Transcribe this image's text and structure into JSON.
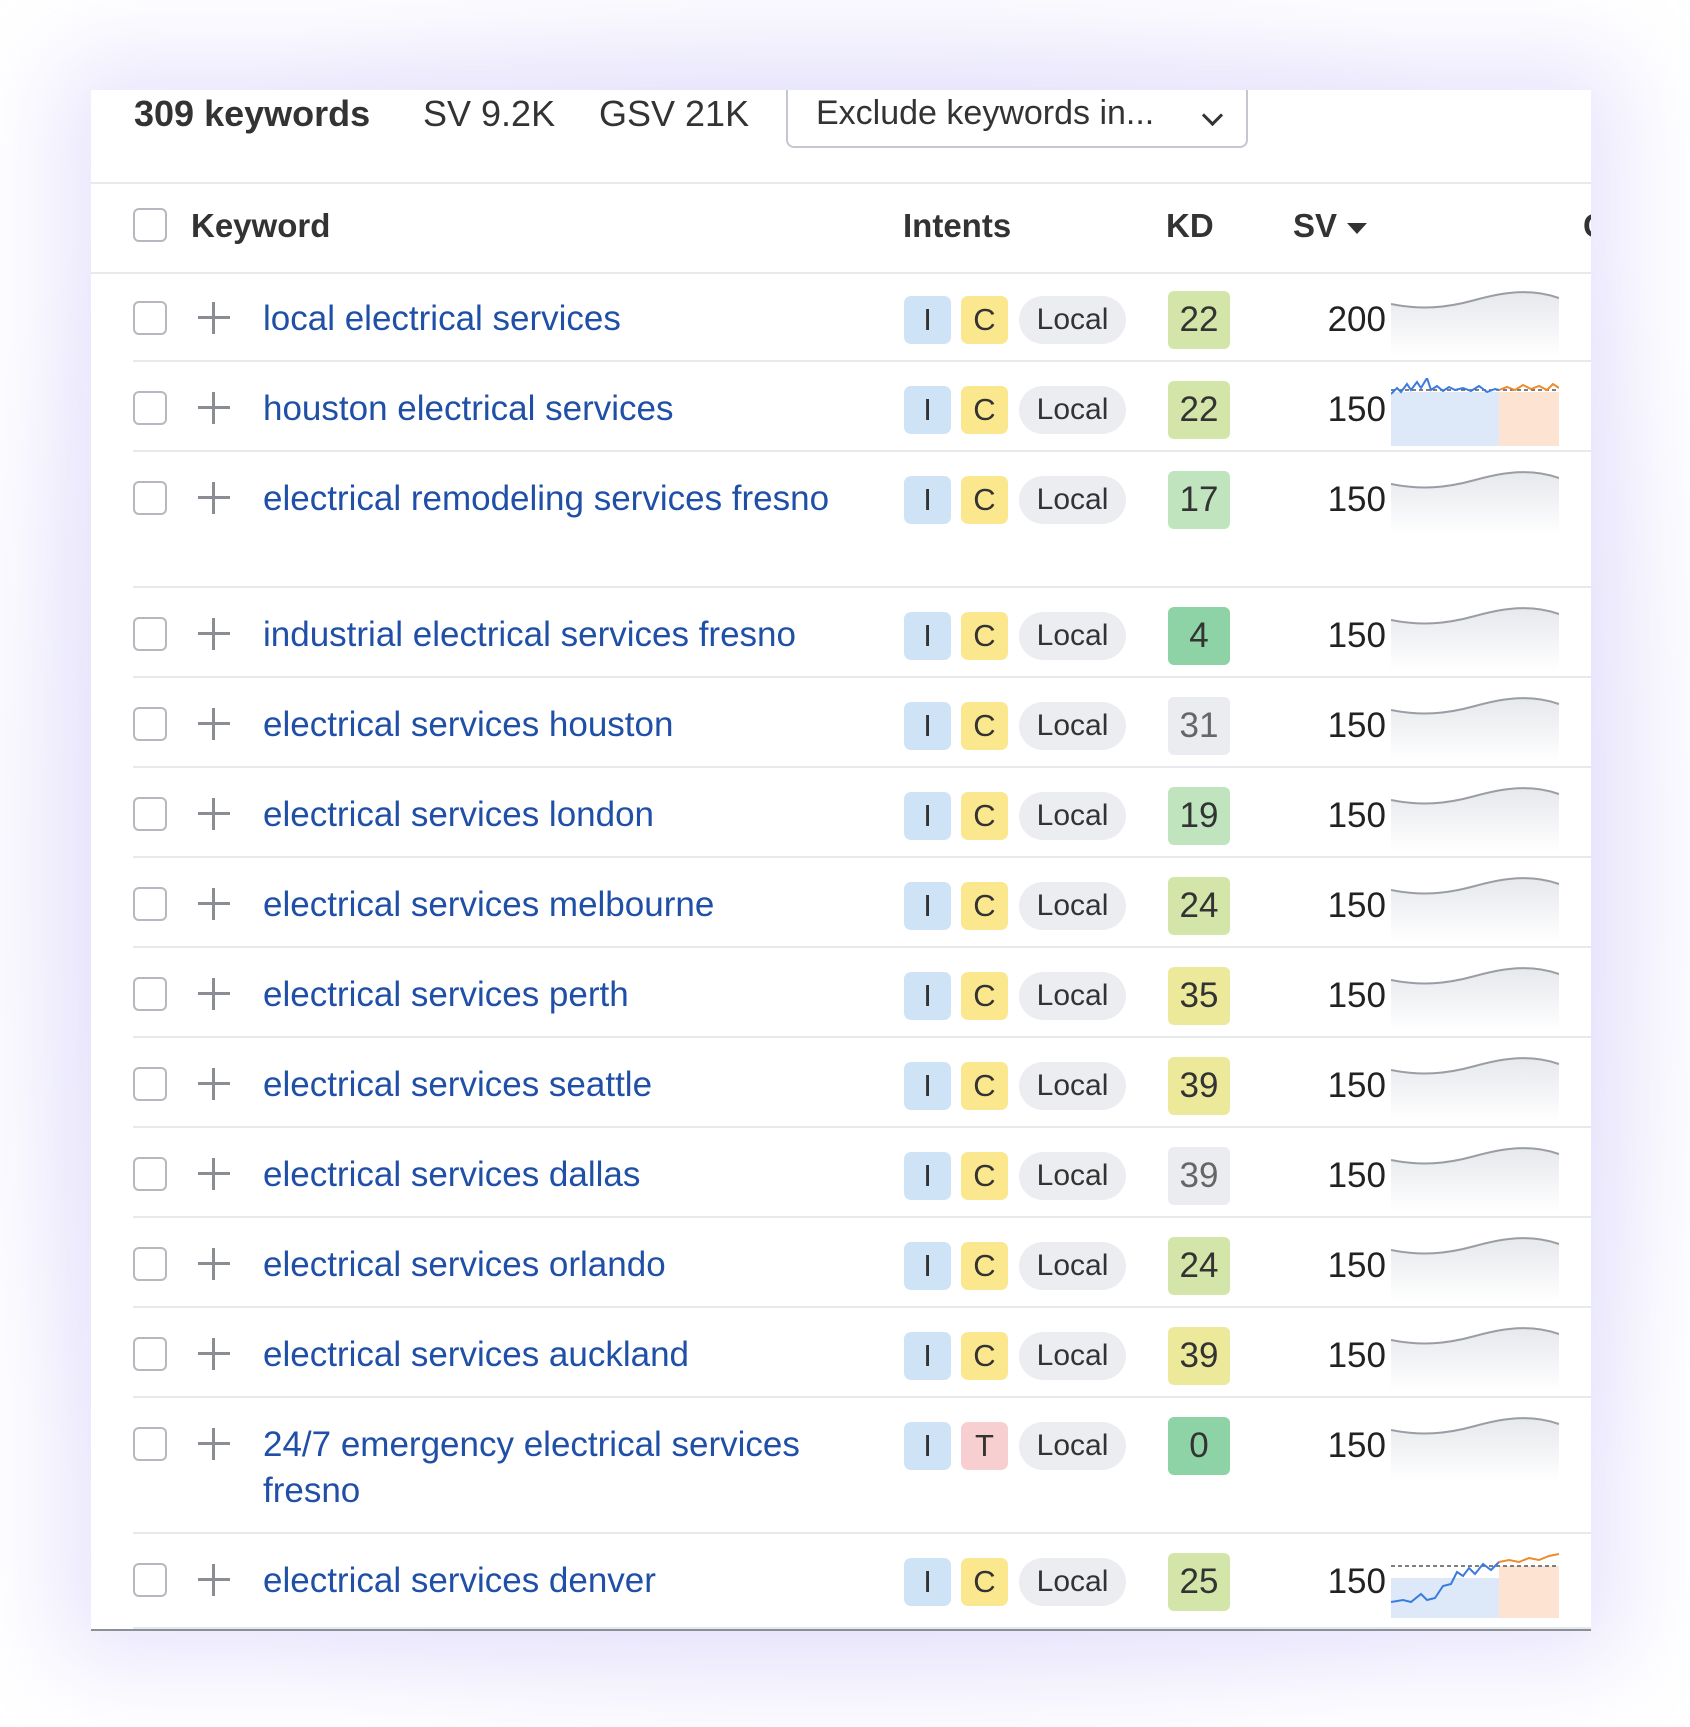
{
  "summary": {
    "keywords_count": "309 keywords",
    "sv": "SV 9.2K",
    "gsv": "GSV 21K",
    "exclude_label": "Exclude keywords in..."
  },
  "headers": {
    "keyword": "Keyword",
    "intents": "Intents",
    "kd": "KD",
    "sv": "SV",
    "sort_icon": "sort-desc-icon",
    "cut_off": "C"
  },
  "colors": {
    "link": "#1f4fa6",
    "intent_informational": "#cfe3f6",
    "intent_commercial": "#fbe78e",
    "intent_transactional": "#f8cfd0",
    "local_badge": "#ebedf0",
    "kd_gray": "#ebecef",
    "trend_blue": "#3a7be0",
    "trend_orange": "#f08a2c"
  },
  "rows": [
    {
      "keyword": "local electrical services",
      "intent1": "I",
      "intent2": "C",
      "intent2_type": "commercial",
      "local": "Local",
      "kd": "22",
      "kd_color": "#d3e5a9",
      "sv": "200",
      "trend": "wave"
    },
    {
      "keyword": "houston electrical services",
      "intent1": "I",
      "intent2": "C",
      "intent2_type": "commercial",
      "local": "Local",
      "kd": "22",
      "kd_color": "#d3e5a9",
      "sv": "150",
      "trend": "data-flat"
    },
    {
      "keyword": "electrical remodeling services fresno",
      "intent1": "I",
      "intent2": "C",
      "intent2_type": "commercial",
      "local": "Local",
      "kd": "17",
      "kd_color": "#bfe4be",
      "sv": "150",
      "trend": "wave"
    },
    {
      "keyword": "industrial electrical services fresno",
      "intent1": "I",
      "intent2": "C",
      "intent2_type": "commercial",
      "local": "Local",
      "kd": "4",
      "kd_color": "#8dd3a6",
      "sv": "150",
      "trend": "wave"
    },
    {
      "keyword": "electrical services houston",
      "intent1": "I",
      "intent2": "C",
      "intent2_type": "commercial",
      "local": "Local",
      "kd": "31",
      "kd_color": "#ebecef",
      "sv": "150",
      "trend": "wave"
    },
    {
      "keyword": "electrical services london",
      "intent1": "I",
      "intent2": "C",
      "intent2_type": "commercial",
      "local": "Local",
      "kd": "19",
      "kd_color": "#bfe4be",
      "sv": "150",
      "trend": "wave"
    },
    {
      "keyword": "electrical services melbourne",
      "intent1": "I",
      "intent2": "C",
      "intent2_type": "commercial",
      "local": "Local",
      "kd": "24",
      "kd_color": "#d3e5a9",
      "sv": "150",
      "trend": "wave"
    },
    {
      "keyword": "electrical services perth",
      "intent1": "I",
      "intent2": "C",
      "intent2_type": "commercial",
      "local": "Local",
      "kd": "35",
      "kd_color": "#ece99a",
      "sv": "150",
      "trend": "wave"
    },
    {
      "keyword": "electrical services seattle",
      "intent1": "I",
      "intent2": "C",
      "intent2_type": "commercial",
      "local": "Local",
      "kd": "39",
      "kd_color": "#ece99a",
      "sv": "150",
      "trend": "wave"
    },
    {
      "keyword": "electrical services dallas",
      "intent1": "I",
      "intent2": "C",
      "intent2_type": "commercial",
      "local": "Local",
      "kd": "39",
      "kd_color": "#ebecef",
      "sv": "150",
      "trend": "wave"
    },
    {
      "keyword": "electrical services orlando",
      "intent1": "I",
      "intent2": "C",
      "intent2_type": "commercial",
      "local": "Local",
      "kd": "24",
      "kd_color": "#d3e5a9",
      "sv": "150",
      "trend": "wave"
    },
    {
      "keyword": "electrical services auckland",
      "intent1": "I",
      "intent2": "C",
      "intent2_type": "commercial",
      "local": "Local",
      "kd": "39",
      "kd_color": "#ece99a",
      "sv": "150",
      "trend": "wave"
    },
    {
      "keyword": "24/7 emergency electrical services fresno",
      "intent1": "I",
      "intent2": "T",
      "intent2_type": "transactional",
      "local": "Local",
      "kd": "0",
      "kd_color": "#8dd3a6",
      "sv": "150",
      "trend": "wave"
    },
    {
      "keyword": "electrical services denver",
      "intent1": "I",
      "intent2": "C",
      "intent2_type": "commercial",
      "local": "Local",
      "kd": "25",
      "kd_color": "#d3e5a9",
      "sv": "150",
      "trend": "data-rising"
    }
  ]
}
